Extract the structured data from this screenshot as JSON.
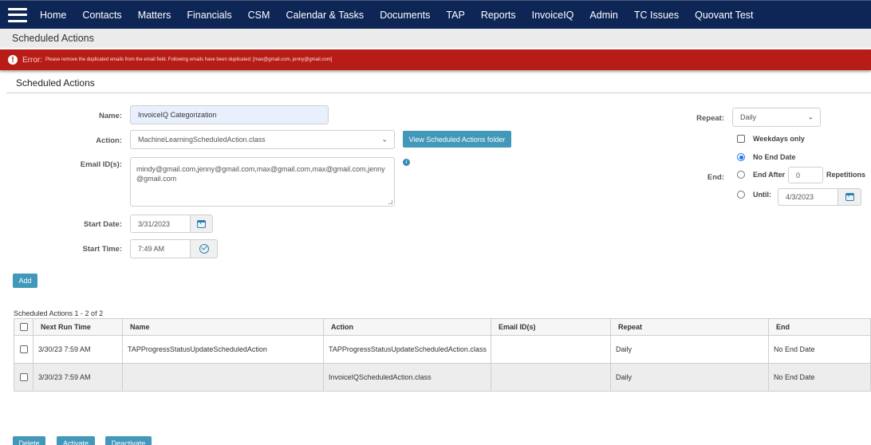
{
  "nav": {
    "menu_icon": "hamburger-menu-icon",
    "items": [
      "Home",
      "Contacts",
      "Matters",
      "Financials",
      "CSM",
      "Calendar & Tasks",
      "Documents",
      "TAP",
      "Reports",
      "InvoiceIQ",
      "Admin",
      "TC Issues",
      "Quovant Test"
    ]
  },
  "breadcrumb": "Scheduled Actions",
  "error": {
    "icon": "exclamation-circle-icon",
    "label": "Error:",
    "message": "Please remove the duplicated emails from the email field. Following emails have been duplicated: [max@gmail.com, jenny@gmail.com]"
  },
  "section_title": "Scheduled Actions",
  "form": {
    "name_label": "Name:",
    "name_value": "InvoiceIQ Categorization",
    "action_label": "Action:",
    "action_value": "MachineLearningScheduledAction.class",
    "view_folder_button": "View Scheduled Actions folder",
    "email_label": "Email ID(s):",
    "email_value": "mindy@gmail.com,jenny@gmail.com,max@gmail.com,max@gmail.com,jenny@gmail.com",
    "info_icon": "i",
    "start_date_label": "Start Date:",
    "start_date_value": "3/31/2023",
    "start_time_label": "Start Time:",
    "start_time_value": "7:49 AM",
    "add_button": "Add"
  },
  "repeat": {
    "label": "Repeat:",
    "value": "Daily",
    "weekdays_only_label": "Weekdays only",
    "weekdays_only_checked": false,
    "end_label": "End:",
    "no_end_date_label": "No End Date",
    "end_after_label": "End After",
    "end_after_value": "0",
    "repetitions_label": "Repetitions",
    "until_label": "Until:",
    "until_value": "4/3/2023",
    "selected_end": "No End Date"
  },
  "table": {
    "caption": "Scheduled Actions  1 - 2 of 2",
    "columns": [
      "Next Run Time",
      "Name",
      "Action",
      "Email ID(s)",
      "Repeat",
      "End"
    ],
    "rows": [
      {
        "next_run": "3/30/23 7:59 AM",
        "name": "TAPProgressStatusUpdateScheduledAction",
        "action": "TAPProgressStatusUpdateScheduledAction.class",
        "emails": "",
        "repeat": "Daily",
        "end": "No End Date"
      },
      {
        "next_run": "3/30/23 7:59 AM",
        "name": "",
        "action": "InvoiceIQScheduledAction.class",
        "emails": "",
        "repeat": "Daily",
        "end": "No End Date"
      }
    ]
  },
  "bottom_buttons": {
    "delete": "Delete",
    "activate": "Activate",
    "deactivate": "Deactivate"
  }
}
